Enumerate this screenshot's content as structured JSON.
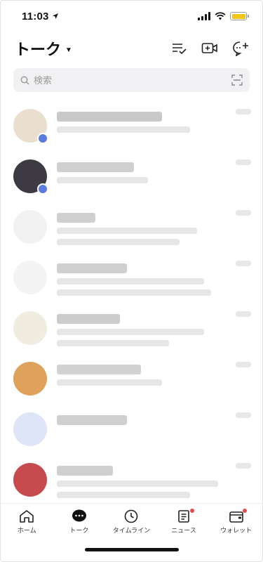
{
  "status_bar": {
    "time": "11:03",
    "battery_color": "#f5c518"
  },
  "header": {
    "title": "トーク"
  },
  "search": {
    "placeholder": "検索"
  },
  "chats": [
    {
      "avatar_color": "#eadfce",
      "name_color": "#c9c9c9",
      "badge": true
    },
    {
      "avatar_color": "#3d3a44",
      "name_color": "#cfcfcf",
      "badge": true
    },
    {
      "avatar_color": "#f2f2f2",
      "name_color": "#d0d0d0",
      "badge": false
    },
    {
      "avatar_color": "#f4f4f4",
      "name_color": "#cfcfcf",
      "badge": false
    },
    {
      "avatar_color": "#f1ece0",
      "name_color": "#cccccc",
      "badge": false
    },
    {
      "avatar_color": "#dfa25a",
      "name_color": "#d2d2d2",
      "badge": false
    },
    {
      "avatar_color": "#dde5f6",
      "name_color": "#cfcfcf",
      "badge": false
    },
    {
      "avatar_color": "#c74a4e",
      "name_color": "#d0d0d0",
      "badge": false
    }
  ],
  "tabbar": {
    "items": [
      {
        "label": "ホーム",
        "icon": "home-icon",
        "notify": false
      },
      {
        "label": "トーク",
        "icon": "chat-icon",
        "notify": false
      },
      {
        "label": "タイムライン",
        "icon": "clock-icon",
        "notify": false
      },
      {
        "label": "ニュース",
        "icon": "news-icon",
        "notify": true
      },
      {
        "label": "ウォレット",
        "icon": "wallet-icon",
        "notify": true
      }
    ]
  }
}
